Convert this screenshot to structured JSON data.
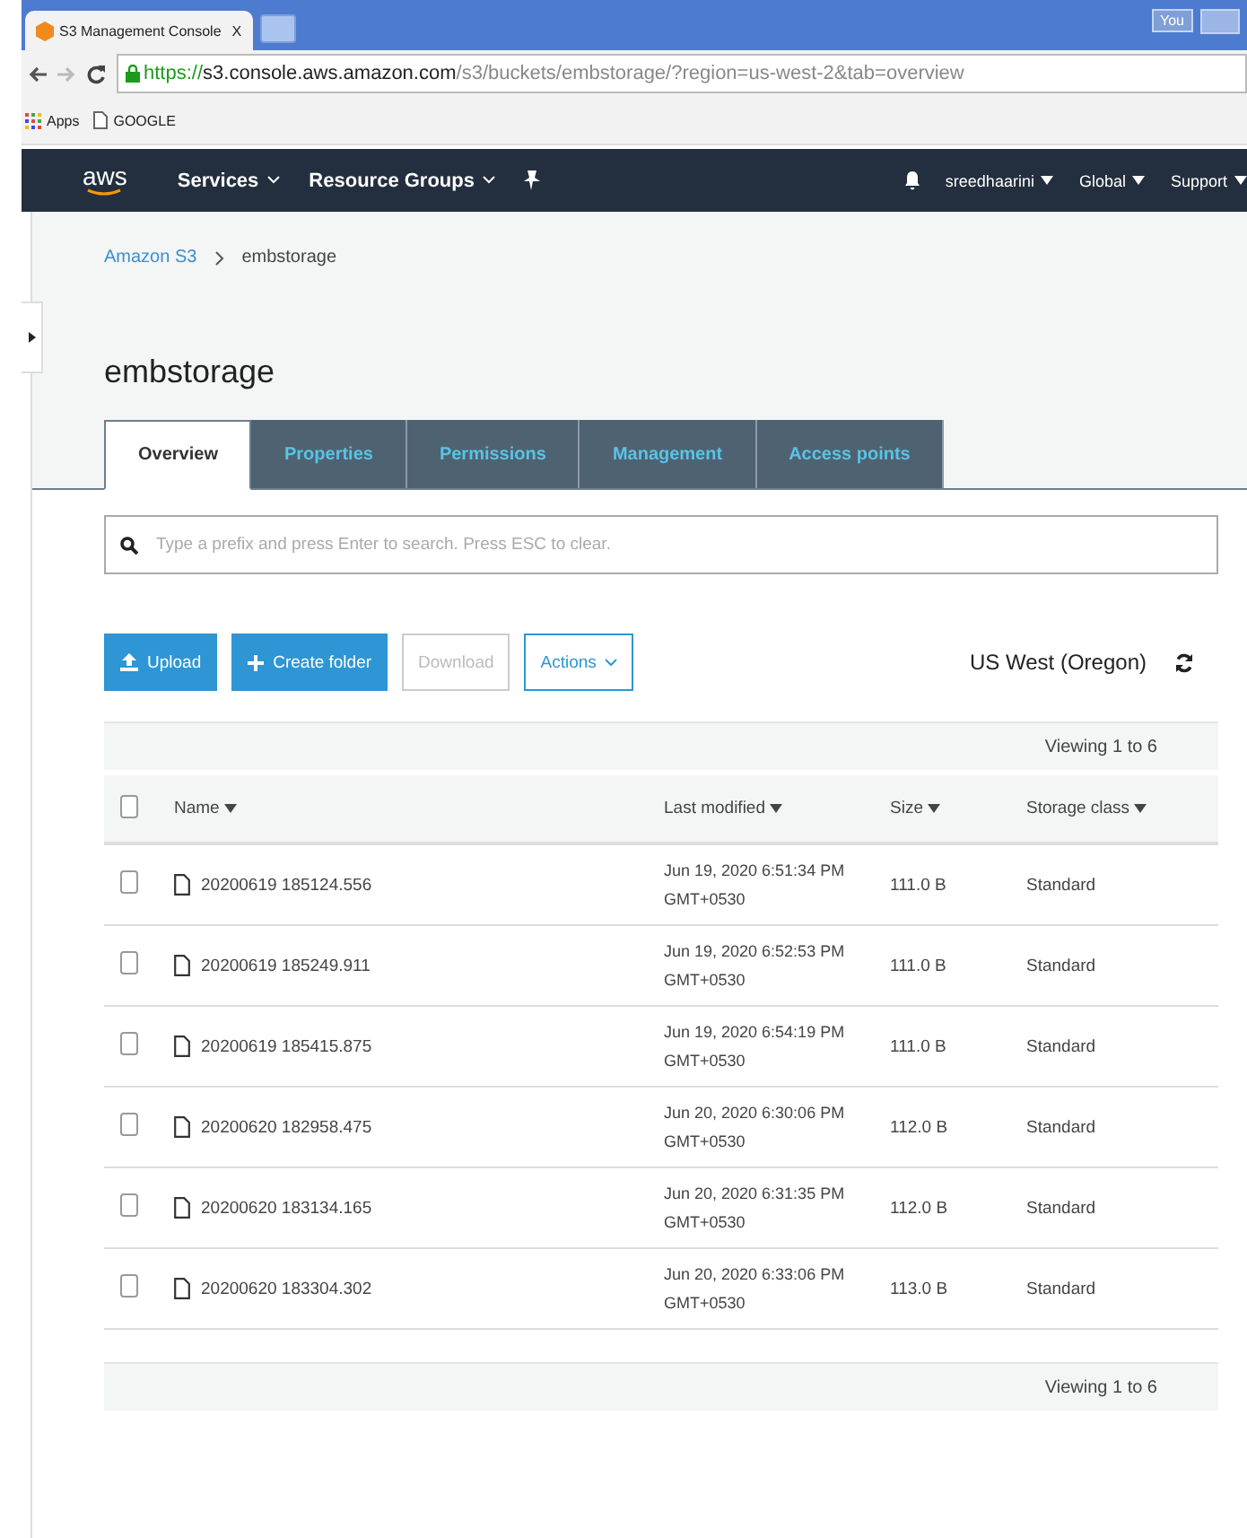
{
  "browser": {
    "tab_title": "S3 Management Console",
    "tab_close": "X",
    "profile": "You",
    "url_scheme": "https://",
    "url_host": "s3.console.aws.amazon.com",
    "url_path": "/s3/buckets/embstorage/?region=us-west-2&tab=overview",
    "bookmarks": [
      {
        "kind": "apps",
        "label": "Apps"
      },
      {
        "kind": "page",
        "label": "GOOGLE"
      }
    ]
  },
  "nav": {
    "logo": "aws",
    "menus": [
      "Services",
      "Resource Groups"
    ],
    "user": "sreedhaarini",
    "region": "Global",
    "support": "Support"
  },
  "breadcrumb": [
    "Amazon S3",
    "embstorage"
  ],
  "title": "embstorage",
  "tabs": [
    {
      "label": "Overview",
      "selected": true
    },
    {
      "label": "Properties",
      "selected": false
    },
    {
      "label": "Permissions",
      "selected": false
    },
    {
      "label": "Management",
      "selected": false
    },
    {
      "label": "Access points",
      "selected": false
    }
  ],
  "search": {
    "placeholder": "Type a prefix and press Enter to search. Press ESC to clear."
  },
  "toolbar": [
    {
      "kind": "upload",
      "label": "Upload",
      "disabled": false
    },
    {
      "kind": "create",
      "label": "Create folder",
      "disabled": false
    },
    {
      "kind": "plain",
      "label": "Download",
      "disabled": true
    },
    {
      "kind": "menu",
      "label": "Actions",
      "disabled": false
    }
  ],
  "region": "US West (Oregon)",
  "viewing_top": "Viewing 1 to 6",
  "table": {
    "select_all_checked": false,
    "columns": [
      "Name",
      "Last modified",
      "Size",
      "Storage class"
    ],
    "rows": [
      {
        "checked": false,
        "name": "20200619 185124.556",
        "modified": "Jun 19, 2020 6:51:34 PM GMT+0530",
        "size": "111.0 B",
        "storage_class": "Standard"
      },
      {
        "checked": false,
        "name": "20200619 185249.911",
        "modified": "Jun 19, 2020 6:52:53 PM GMT+0530",
        "size": "111.0 B",
        "storage_class": "Standard"
      },
      {
        "checked": false,
        "name": "20200619 185415.875",
        "modified": "Jun 19, 2020 6:54:19 PM GMT+0530",
        "size": "111.0 B",
        "storage_class": "Standard"
      },
      {
        "checked": false,
        "name": "20200620 182958.475",
        "modified": "Jun 20, 2020 6:30:06 PM GMT+0530",
        "size": "112.0 B",
        "storage_class": "Standard"
      },
      {
        "checked": false,
        "name": "20200620 183134.165",
        "modified": "Jun 20, 2020 6:31:35 PM GMT+0530",
        "size": "112.0 B",
        "storage_class": "Standard"
      },
      {
        "checked": false,
        "name": "20200620 183304.302",
        "modified": "Jun 20, 2020 6:33:06 PM GMT+0530",
        "size": "113.0 B",
        "storage_class": "Standard"
      }
    ]
  },
  "viewing_bottom": "Viewing 1 to 6"
}
